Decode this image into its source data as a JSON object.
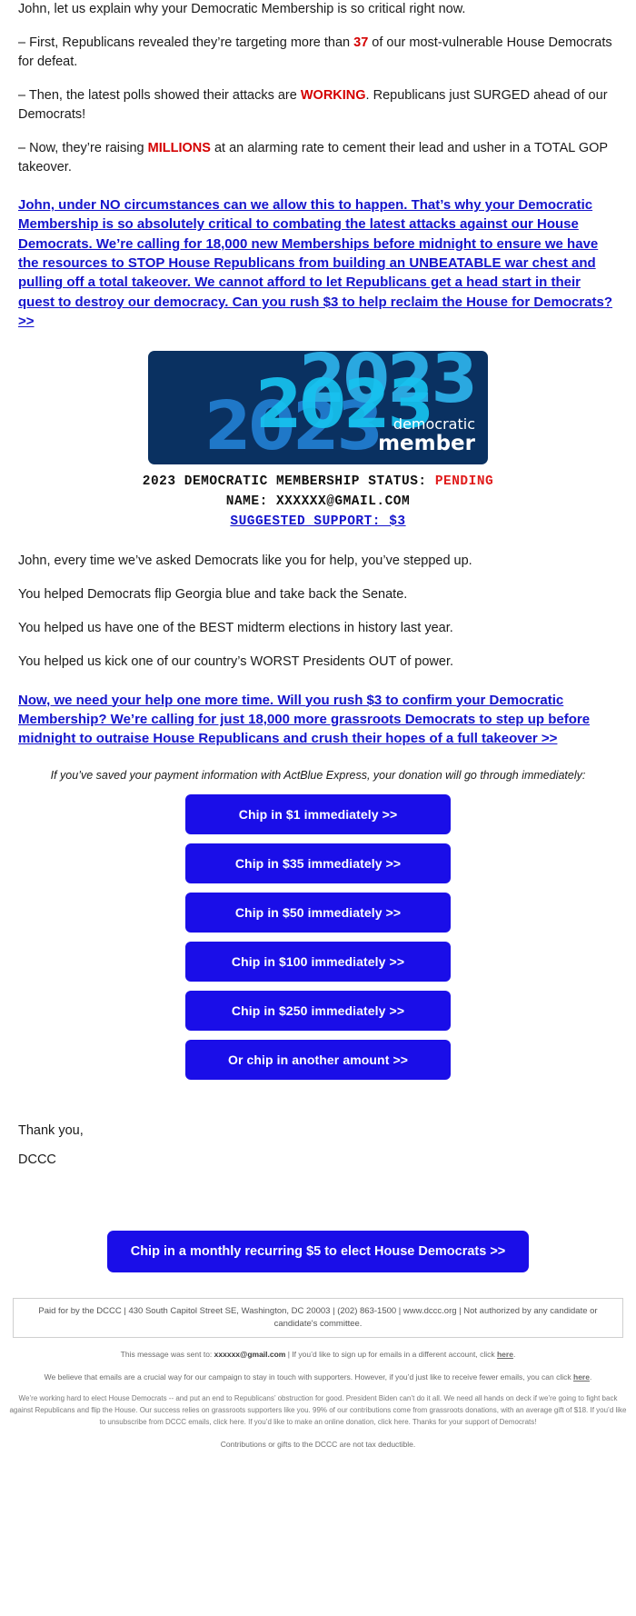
{
  "intro": {
    "greeting": "John, let us explain why your Democratic Membership is so critical right now.",
    "bullet1_a": "– First, Republicans revealed they’re targeting more than ",
    "bullet1_em": "37",
    "bullet1_b": " of our most-vulnerable House Democrats for defeat.",
    "bullet2_a": "– Then, the latest polls showed their attacks are ",
    "bullet2_em": "WORKING",
    "bullet2_b": ". Republicans just SURGED ahead of our Democrats!",
    "bullet3_a": "– Now, they’re raising ",
    "bullet3_em": "MILLIONS",
    "bullet3_b": " at an alarming rate to cement their lead and usher in a TOTAL GOP takeover."
  },
  "call_to_action_1": "John, under NO circumstances can we allow this to happen. That’s why your Democratic Membership is so absolutely critical to combating the latest attacks against our House Democrats. We’re calling for 18,000 new Memberships before midnight to ensure we have the resources to STOP House Republicans from building an UNBEATABLE war chest and pulling off a total takeover. We cannot afford to let Republicans get a head start in their quest to destroy our democracy. Can you rush $3 to help reclaim the House for Democrats? >>",
  "card": {
    "year": "2023",
    "label_small": "democratic",
    "label_large": "member",
    "status_label": "2023 DEMOCRATIC MEMBERSHIP STATUS:",
    "status_value": "PENDING",
    "name_label": "NAME:",
    "name_value": "XXXXXX@GMAIL.COM",
    "support_line": "SUGGESTED SUPPORT: $3"
  },
  "middle": {
    "p1": "John, every time we’ve asked Democrats like you for help, you’ve stepped up.",
    "p2": "You helped Democrats flip Georgia blue and take back the Senate.",
    "p3": "You helped us have one of the BEST midterm elections in history last year.",
    "p4": "You helped us kick one of our country’s WORST Presidents OUT of power."
  },
  "call_to_action_2": "Now, we need your help one more time. Will you rush $3 to confirm your Democratic Membership? We’re calling for just 18,000 more grassroots Democrats to step up before midnight to outraise House Republicans and crush their hopes of a full takeover >>",
  "actblue_note": "If you’ve saved your payment information with ActBlue Express, your donation will go through immediately:",
  "donate_buttons": [
    {
      "label": "Chip in $1 immediately >>"
    },
    {
      "label": "Chip in $35 immediately >>"
    },
    {
      "label": "Chip in $50 immediately >>"
    },
    {
      "label": "Chip in $100 immediately >>"
    },
    {
      "label": "Chip in $250 immediately >>"
    },
    {
      "label": "Or chip in another amount >>"
    }
  ],
  "signoff": {
    "thanks": "Thank you,",
    "org": "DCCC"
  },
  "recurring_button": "Chip in a monthly recurring $5 to elect House Democrats >>",
  "footer": {
    "disclaimer": "Paid for by the DCCC | 430 South Capitol Street SE, Washington, DC 20003 | (202) 863-1500 | www.dccc.org | Not authorized by any candidate or candidate's committee.",
    "sent_to_prefix": "This message was sent to: ",
    "sent_to_email": "xxxxxx@gmail.com",
    "sent_to_suffix_a": " | If you’d like to sign up for emails in a different account, click ",
    "sent_to_link": "here",
    "sent_to_suffix_b": ".",
    "fewer_a": "We believe that emails are a crucial way for our campaign to stay in touch with supporters. However, if you’d just like to receive fewer emails, you can click ",
    "fewer_link": "here",
    "fewer_b": ".",
    "block_a": "We’re working hard to elect House Democrats -- and put an end to Republicans’ obstruction for good. President Biden can’t do it all. We need all hands on deck if we’re going to fight back against Republicans and flip the House. Our success relies on grassroots supporters like you. 99% of our contributions come from grassroots donations, with an average gift of $18. If you’d like to unsubscribe from DCCC emails, click ",
    "block_link1": "here",
    "block_b": ". If you’d like to make an online donation, click ",
    "block_link2": "here",
    "block_c": ". Thanks for your support of Democrats!",
    "tax": "Contributions or gifts to the DCCC are not tax deductible."
  },
  "colors": {
    "link_blue": "#1414cc",
    "button_blue": "#1a0ee8",
    "accent_red": "#d40000",
    "card_navy": "#0a3161"
  }
}
